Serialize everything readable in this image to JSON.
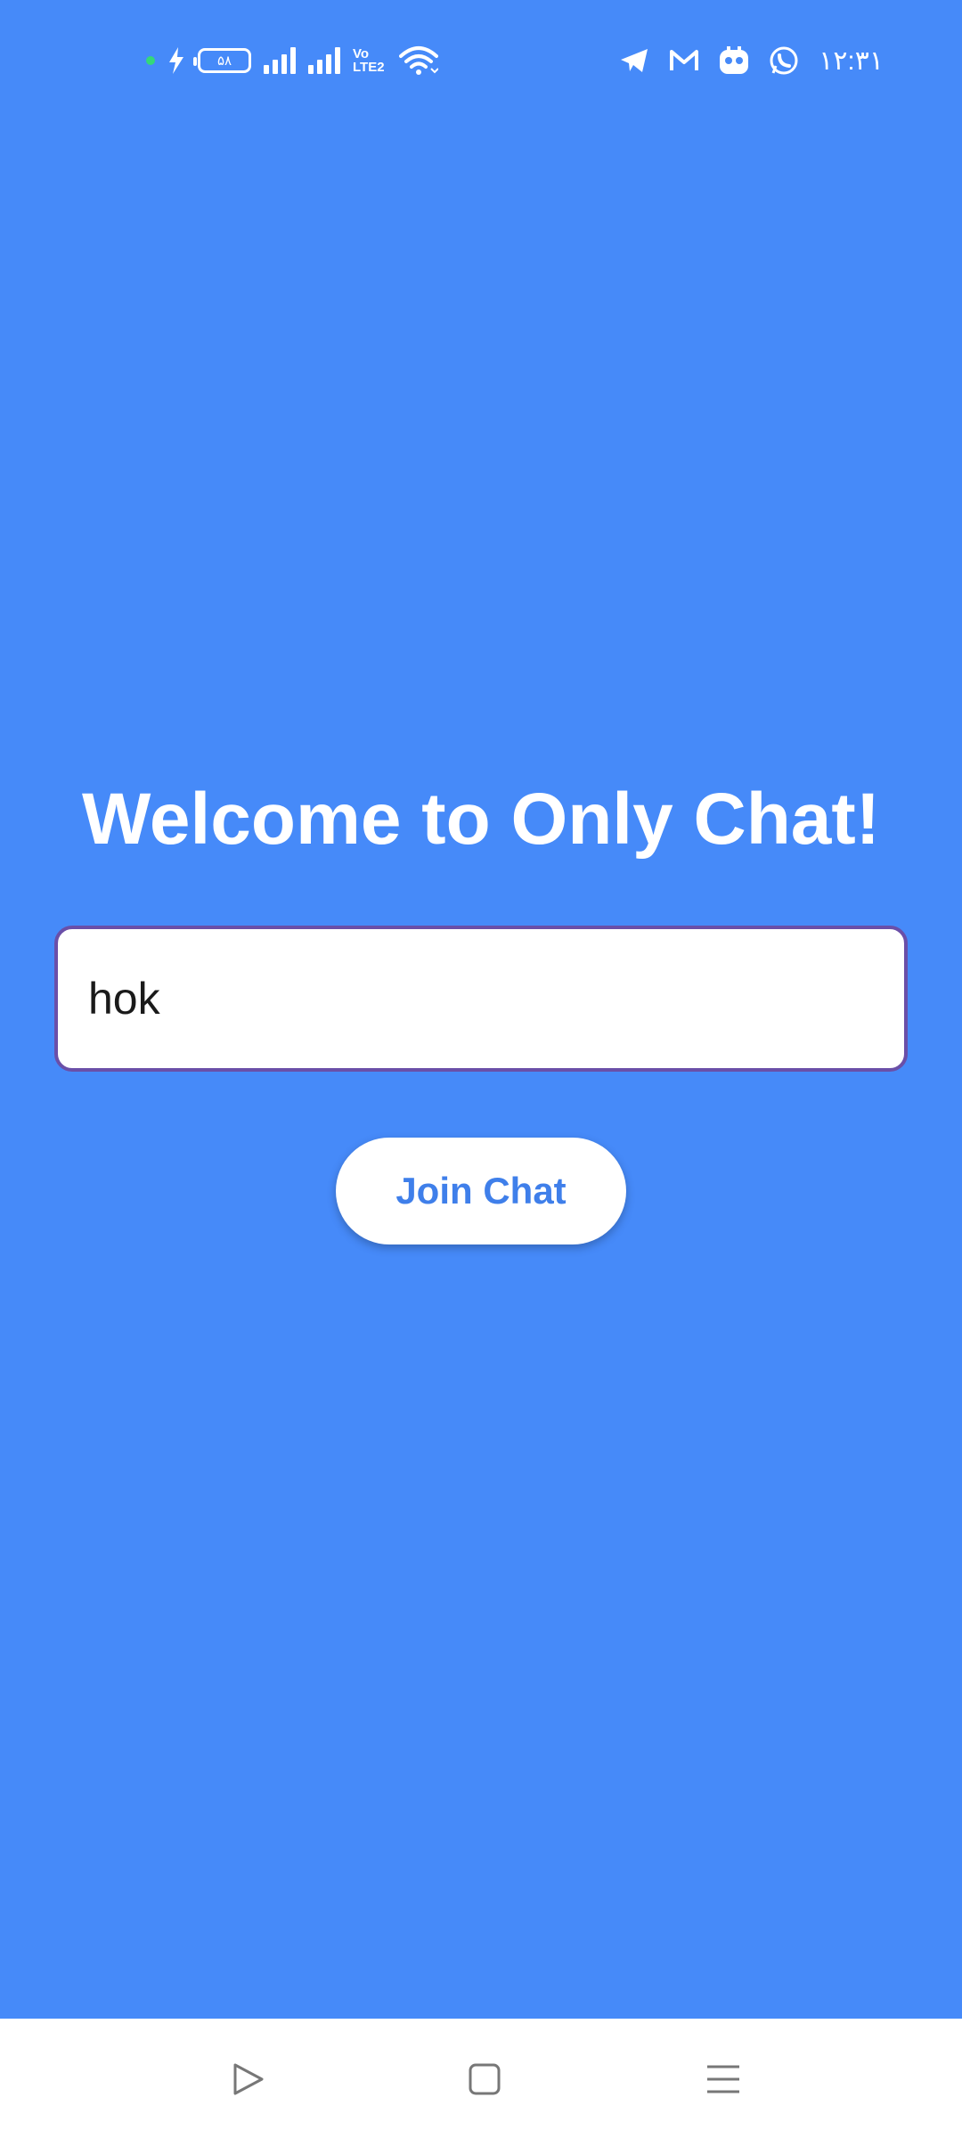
{
  "status_bar": {
    "battery_level": "۵۸",
    "network_type": "Vo LTE2",
    "time": "۱۲:۳۱",
    "left_icons": [
      "green-dot-indicator",
      "charging-bolt-icon",
      "battery-icon",
      "signal-1-icon",
      "signal-2-icon",
      "volte-icon",
      "wifi-icon"
    ],
    "right_icons": [
      "telegram-icon",
      "gmail-icon",
      "app-notification-icon",
      "whatsapp-icon"
    ]
  },
  "main": {
    "title": "Welcome to Only Chat!",
    "name_input": {
      "value": "hok"
    },
    "join_button_label": "Join Chat"
  },
  "nav_bar": {
    "items": [
      "back-triangle-icon",
      "home-square-icon",
      "recents-menu-icon"
    ]
  },
  "colors": {
    "background": "#468af9",
    "button_text": "#3f7fea",
    "input_border": "#6a4fa8"
  }
}
